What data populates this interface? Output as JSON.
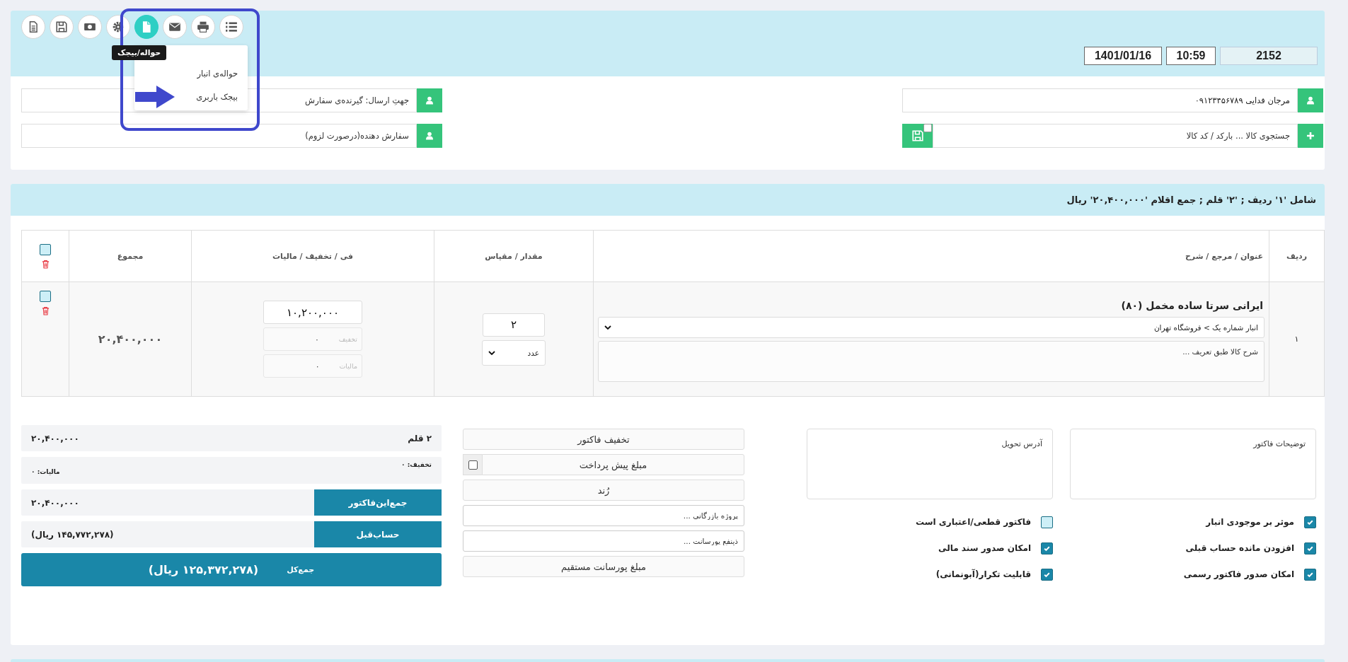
{
  "toolbar": [
    {
      "kind": "doc",
      "selected": false
    },
    {
      "kind": "save",
      "selected": false
    },
    {
      "kind": "money",
      "selected": false
    },
    {
      "kind": "gear",
      "selected": false
    },
    {
      "kind": "file",
      "selected": true
    },
    {
      "kind": "mail",
      "selected": false
    },
    {
      "kind": "print",
      "selected": false
    },
    {
      "kind": "list",
      "selected": false
    }
  ],
  "tooltip": "حواله/بیجک",
  "dropdown": [
    {
      "label": "حواله‌ی انبار"
    },
    {
      "label": "بیجک باربری"
    }
  ],
  "doc_number": "2152",
  "time": "10:59",
  "date": "1401/01/16",
  "customer_fields": [
    {
      "kind": "person",
      "value": "مرجان فدایی ۰۹۱۲۳۴۵۶۷۸۹"
    },
    {
      "kind": "search",
      "placeholder": "جستجوی کالا ... بارکد / کد کالا",
      "checked": false
    }
  ],
  "order_fields": [
    {
      "kind": "person",
      "placeholder": "جهتِ ارسال: گیرنده‌ی سفارش"
    },
    {
      "kind": "person",
      "placeholder": "سفارش دهنده(درصورت لزوم)"
    }
  ],
  "summary": "شامل '۱' ردیف ; '۲' قلم ; جمع اقلام '۲۰,۴۰۰,۰۰۰' ریال",
  "table": {
    "columns": [
      "ردیف",
      "عنوان / مرجع / شرح",
      "مقدار / مقیاس",
      "فی / تخفیف / مالیات",
      "مجموع"
    ],
    "header_checked": false,
    "rows": [
      {
        "index": "۱",
        "title": "ایرانی سرتا ساده مخمل (۸۰)",
        "warehouse": "انبار شماره یک > فروشگاه تهران",
        "description_placeholder": "شرح کالا طبق تعریف ...",
        "quantity": "۲",
        "unit": "عدد",
        "price": "۱۰,۲۰۰,۰۰۰",
        "discount_label": "تخفیف",
        "discount": "۰",
        "tax_label": "مالیات",
        "tax": "۰",
        "total": "۲۰,۴۰۰,۰۰۰",
        "checked": false
      }
    ]
  },
  "notes": {
    "placeholder": "توضیحات فاکتور"
  },
  "address": {
    "placeholder": "آدرس تحویل"
  },
  "options": [
    [
      {
        "label": "موثر بر موجودی انبار",
        "checked": true
      },
      {
        "label": "افزودن مانده حساب قبلی",
        "checked": true
      },
      {
        "label": "امکان صدور فاکتور رسمی",
        "checked": true
      }
    ],
    [
      {
        "label": "فاکتور قطعی/اعتباری است",
        "checked": false
      },
      {
        "label": "امکان صدور سند مالی",
        "checked": true
      },
      {
        "label": "قابلیت تکرار(آبونمانی)",
        "checked": true
      }
    ]
  ],
  "actions": [
    {
      "kind": "button",
      "label": "تخفیف فاکتور"
    },
    {
      "kind": "check",
      "label": "مبلغ پیش پرداخت",
      "checked": false
    },
    {
      "kind": "button",
      "label": "رُند"
    },
    {
      "kind": "field",
      "placeholder": "پروژه بازرگانی ..."
    },
    {
      "kind": "field",
      "placeholder": "ذینفع پورسانت ..."
    },
    {
      "kind": "button",
      "label": "مبلغ پورسانت مستقیم"
    }
  ],
  "totals": {
    "items_count": "۲ قلم",
    "items_total": "۲۰,۴۰۰,۰۰۰",
    "discount": "تخفیف: ۰",
    "tax": "مالیات: ۰",
    "invoice_label": "جمع‌این‌فاکتور",
    "invoice_total": "۲۰,۴۰۰,۰۰۰",
    "previous_label": "حساب‌قبل",
    "previous_total": "(۱۴۵,۷۷۲,۲۷۸ ریال)",
    "grand_label": "جمع‌کل",
    "grand_total": "(۱۲۵,۳۷۲,۲۷۸ ریال)"
  }
}
